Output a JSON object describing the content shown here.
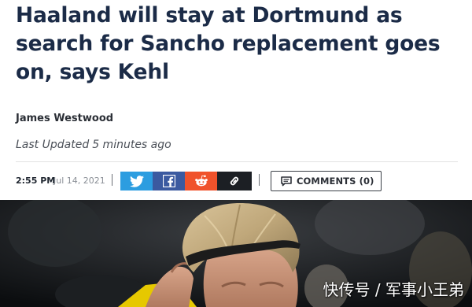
{
  "article": {
    "headline": "Haaland will stay at Dortmund as search for Sancho replacement goes on, says Kehl",
    "author": "James Westwood",
    "updated_label": "Last Updated",
    "updated_ago": "5 minutes ago",
    "time": "2:55 PM",
    "date": "Jul 14, 2021"
  },
  "share": {
    "twitter_icon": "twitter-icon",
    "facebook_icon": "facebook-icon",
    "reddit_icon": "reddit-icon",
    "link_icon": "link-icon"
  },
  "comments": {
    "icon": "comment-icon",
    "label": "COMMENTS (0)"
  },
  "photo": {
    "watermark": "快传号 / 军事小王弟"
  },
  "colors": {
    "headline": "#1b2b47",
    "twitter": "#2c9de0",
    "facebook": "#3b5aa0",
    "reddit": "#f0522b",
    "link": "#1c1f24",
    "jersey_yellow": "#f2d200"
  }
}
